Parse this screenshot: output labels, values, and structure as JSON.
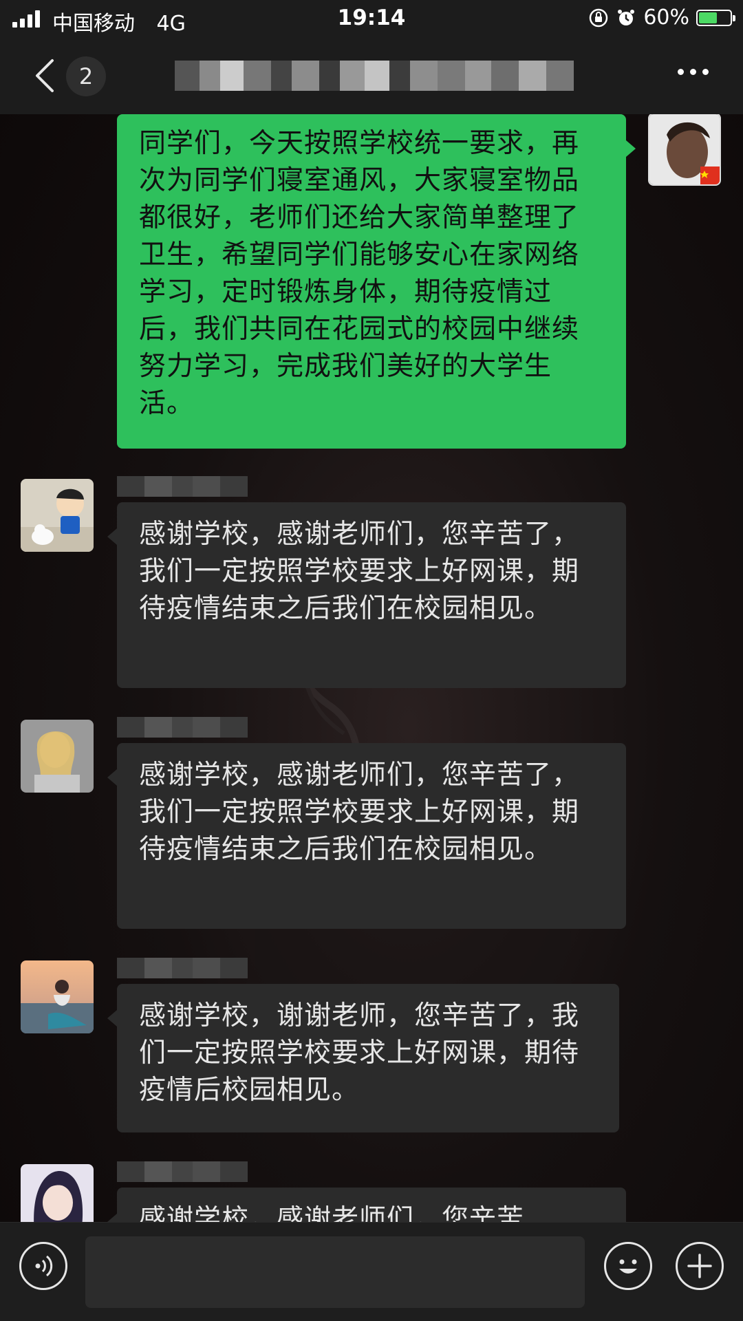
{
  "status_bar": {
    "carrier": "中国移动",
    "network": "4G",
    "time": "19:14",
    "battery": "60%",
    "battery_level": 0.6
  },
  "nav": {
    "back_count": "2",
    "more_icon": "more-dots-icon"
  },
  "messages": [
    {
      "direction": "out",
      "text": "同学们，今天按照学校统一要求，再次为同学们寝室通风，大家寝室物品都很好，老师们还给大家简单整理了卫生，希望同学们能够安心在家网络学习，定时锻炼身体，期待疫情过后，我们共同在花园式的校园中继续努力学习，完成我们美好的大学生活。"
    },
    {
      "direction": "in",
      "text": "感谢学校，感谢老师们，您辛苦了，我们一定按照学校要求上好网课，期待疫情结束之后我们在校园相见。"
    },
    {
      "direction": "in",
      "text": "感谢学校，感谢老师们，您辛苦了，我们一定按照学校要求上好网课，期待疫情结束之后我们在校园相见。"
    },
    {
      "direction": "in",
      "text": "感谢学校，谢谢老师，您辛苦了，我们一定按照学校要求上好网课，期待疫情后校园相见。"
    },
    {
      "direction": "in",
      "text": "感谢学校，感谢老师们，您辛苦"
    }
  ],
  "colors": {
    "outgoing_bubble": "#2ec05c",
    "incoming_bubble": "#2b2b2b",
    "bar": "#1c1c1c"
  },
  "input_bar": {
    "voice_icon": "voice-icon",
    "emoji_icon": "emoji-icon",
    "plus_icon": "plus-icon"
  }
}
